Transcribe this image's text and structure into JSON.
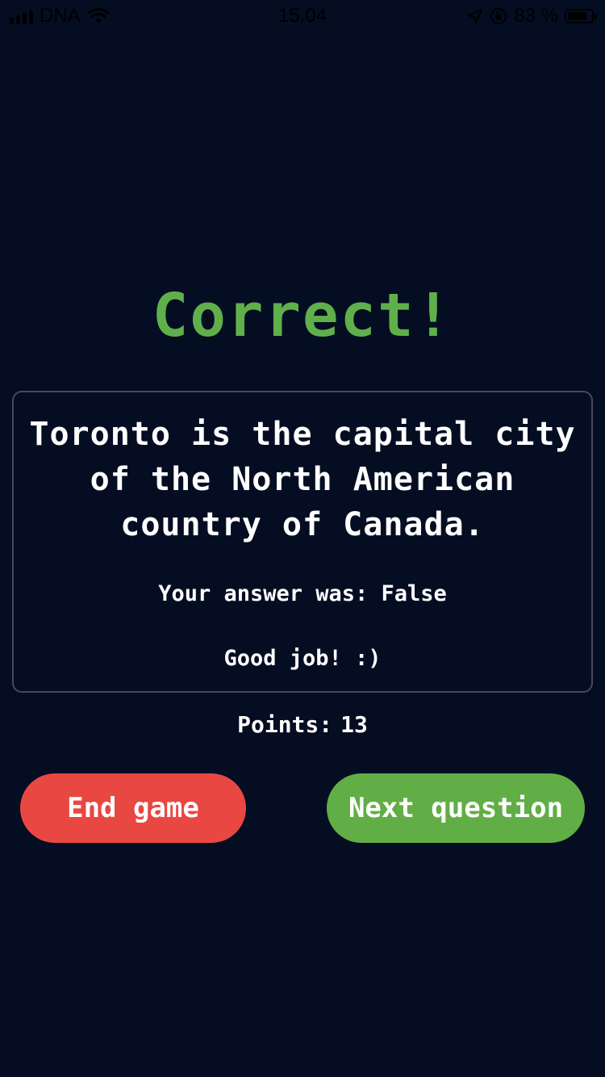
{
  "status_bar": {
    "carrier": "DNA",
    "time": "15.04",
    "battery_percent_label": "83 %",
    "battery_level": 0.83,
    "icons": [
      "signal-icon",
      "wifi-icon",
      "location-icon",
      "orientation-lock-icon",
      "battery-icon"
    ]
  },
  "result": {
    "title": "Correct!",
    "title_color": "#5fb04a"
  },
  "question": {
    "text": "Toronto is the capital city of the North American country of Canada.",
    "answer_line": "Your answer was: False",
    "feedback": "Good job! :)"
  },
  "score": {
    "label": "Points:",
    "value": "13"
  },
  "buttons": {
    "end_game": "End game",
    "next_question": "Next question",
    "end_color": "#e94742",
    "next_color": "#61ae46"
  },
  "colors": {
    "background": "#040d22",
    "card_border": "#4a4860",
    "text": "#ffffff"
  }
}
